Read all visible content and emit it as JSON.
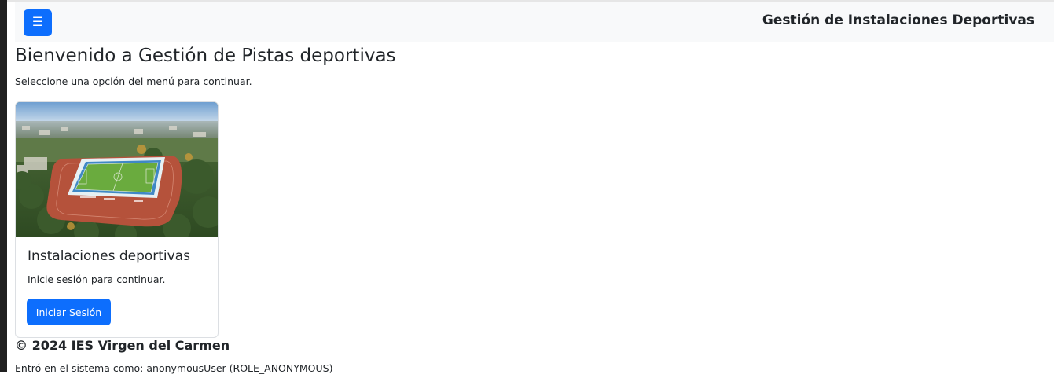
{
  "navbar": {
    "menu_icon": "☰",
    "brand": "Gestión de Instalaciones Deportivas"
  },
  "main": {
    "title": "Bienvenido a Gestión de Pistas deportivas",
    "subtitle": "Seleccione una opción del menú para continuar."
  },
  "card": {
    "image": "stadium-aerial-photo",
    "title": "Instalaciones deportivas",
    "text": "Inicie sesión para continuar.",
    "button_label": "Iniciar Sesión"
  },
  "footer": {
    "copyright": "© 2024 IES Virgen del Carmen",
    "user_info": "Entró en el sistema como: anonymousUser (ROLE_ANONYMOUS)"
  },
  "colors": {
    "primary": "#0d6efd",
    "navbar_bg": "#f8f9fa",
    "text": "#212529"
  }
}
